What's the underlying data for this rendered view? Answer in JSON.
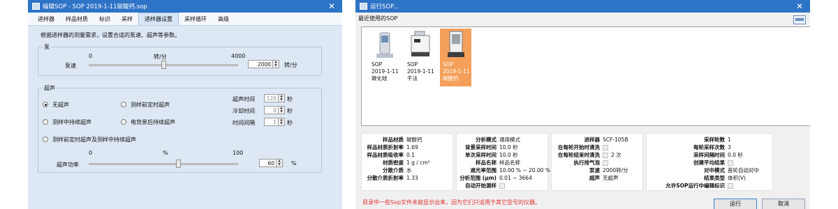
{
  "edit_window": {
    "title": "编辑SOP - SOP 2019-1-11碳酸钙.sop",
    "tabs": [
      "进样器",
      "样品材质",
      "标识",
      "采样",
      "进样器设置",
      "采样循环",
      "高级"
    ],
    "selected_tab": 4,
    "description": "根据进样器的测量需求，设置合适的泵速、超声等参数。",
    "pump": {
      "group_label": "泵",
      "label": "泵速",
      "min_label": "0",
      "unit_label": "转/分",
      "max_label": "4000",
      "value": "2000",
      "value_unit": "转/分",
      "slider_fraction": 0.5
    },
    "ultrasound": {
      "group_label": "超声",
      "options": [
        "无超声",
        "测样前定时超声",
        "测样中持续超声",
        "电背景后持续超声",
        "测样前定时超声及测样中持续超声"
      ],
      "selected_option": 0,
      "time_label": "超声时间",
      "time_value": "120",
      "cool_label": "冷却时间",
      "cool_value": "0",
      "interval_label": "时间间隔",
      "interval_value": "1",
      "seconds_unit": "秒",
      "power_label": "超声功率",
      "power_min": "0",
      "power_unit_label": "%",
      "power_max": "100",
      "power_value": "60",
      "power_unit": "%",
      "power_fraction": 0.6
    }
  },
  "run_window": {
    "title": "运行SOP...",
    "section_label": "最近使用的SOP",
    "items": [
      {
        "line1": "SOP",
        "line2": "2019-1-11",
        "line3": "碳化硅"
      },
      {
        "line1": "SOP",
        "line2": "2019-1-11",
        "line3": "干法"
      },
      {
        "line1": "SOP",
        "line2": "2019-1-11",
        "line3": "碳酸钙"
      }
    ],
    "selected_item": 2,
    "info_col1": [
      {
        "k": "样品材质",
        "v": "碳酸钙"
      },
      {
        "k": "样品材质折射率",
        "v": "1.69"
      },
      {
        "k": "样品材质吸收率",
        "v": "0.1"
      },
      {
        "k": "材质密度",
        "v": "1 g / cm³"
      },
      {
        "k": "分散介质",
        "v": "水"
      },
      {
        "k": "分散介质折射率",
        "v": "1.33"
      }
    ],
    "info_col2": [
      {
        "k": "分析模式",
        "v": "通用模式"
      },
      {
        "k": "背景采样时间",
        "v": "10.0 秒"
      },
      {
        "k": "单次采样时间",
        "v": "10.0 秒"
      },
      {
        "k": "样品名称",
        "v": "样品名称"
      },
      {
        "k": "遮光率范围",
        "v": "10.00 % ~ 20.00 %"
      },
      {
        "k": "分析范围 (μm)",
        "v": "0.01 ~ 3664"
      },
      {
        "k": "自动开始测样",
        "v": ""
      }
    ],
    "info_col3": [
      {
        "k": "进样器",
        "v": "SCF-105B"
      },
      {
        "k": "在每轮开始时清洗",
        "v": ""
      },
      {
        "k": "在每轮结束时清洗",
        "v": "2 次"
      },
      {
        "k": "执行排气泡",
        "v": ""
      },
      {
        "k": "泵速",
        "v": "2000转/分"
      },
      {
        "k": "超声",
        "v": "无超声"
      }
    ],
    "info_col4": [
      {
        "k": "采样轮数",
        "v": "1"
      },
      {
        "k": "每轮采样次数",
        "v": "3"
      },
      {
        "k": "采样间隔时间",
        "v": "0.0 秒"
      },
      {
        "k": "创建平均结果",
        "v": ""
      },
      {
        "k": "对中模式",
        "v": "首轮自动对中"
      },
      {
        "k": "结果类型",
        "v": "体积(V)"
      },
      {
        "k": "允许SOP运行中编辑标识",
        "v": ""
      }
    ],
    "warning": "目录中一些Sop文件未被显示出来，因为它们只适用于其它型号的仪器。",
    "run_button": "运行",
    "cancel_button": "取消"
  }
}
